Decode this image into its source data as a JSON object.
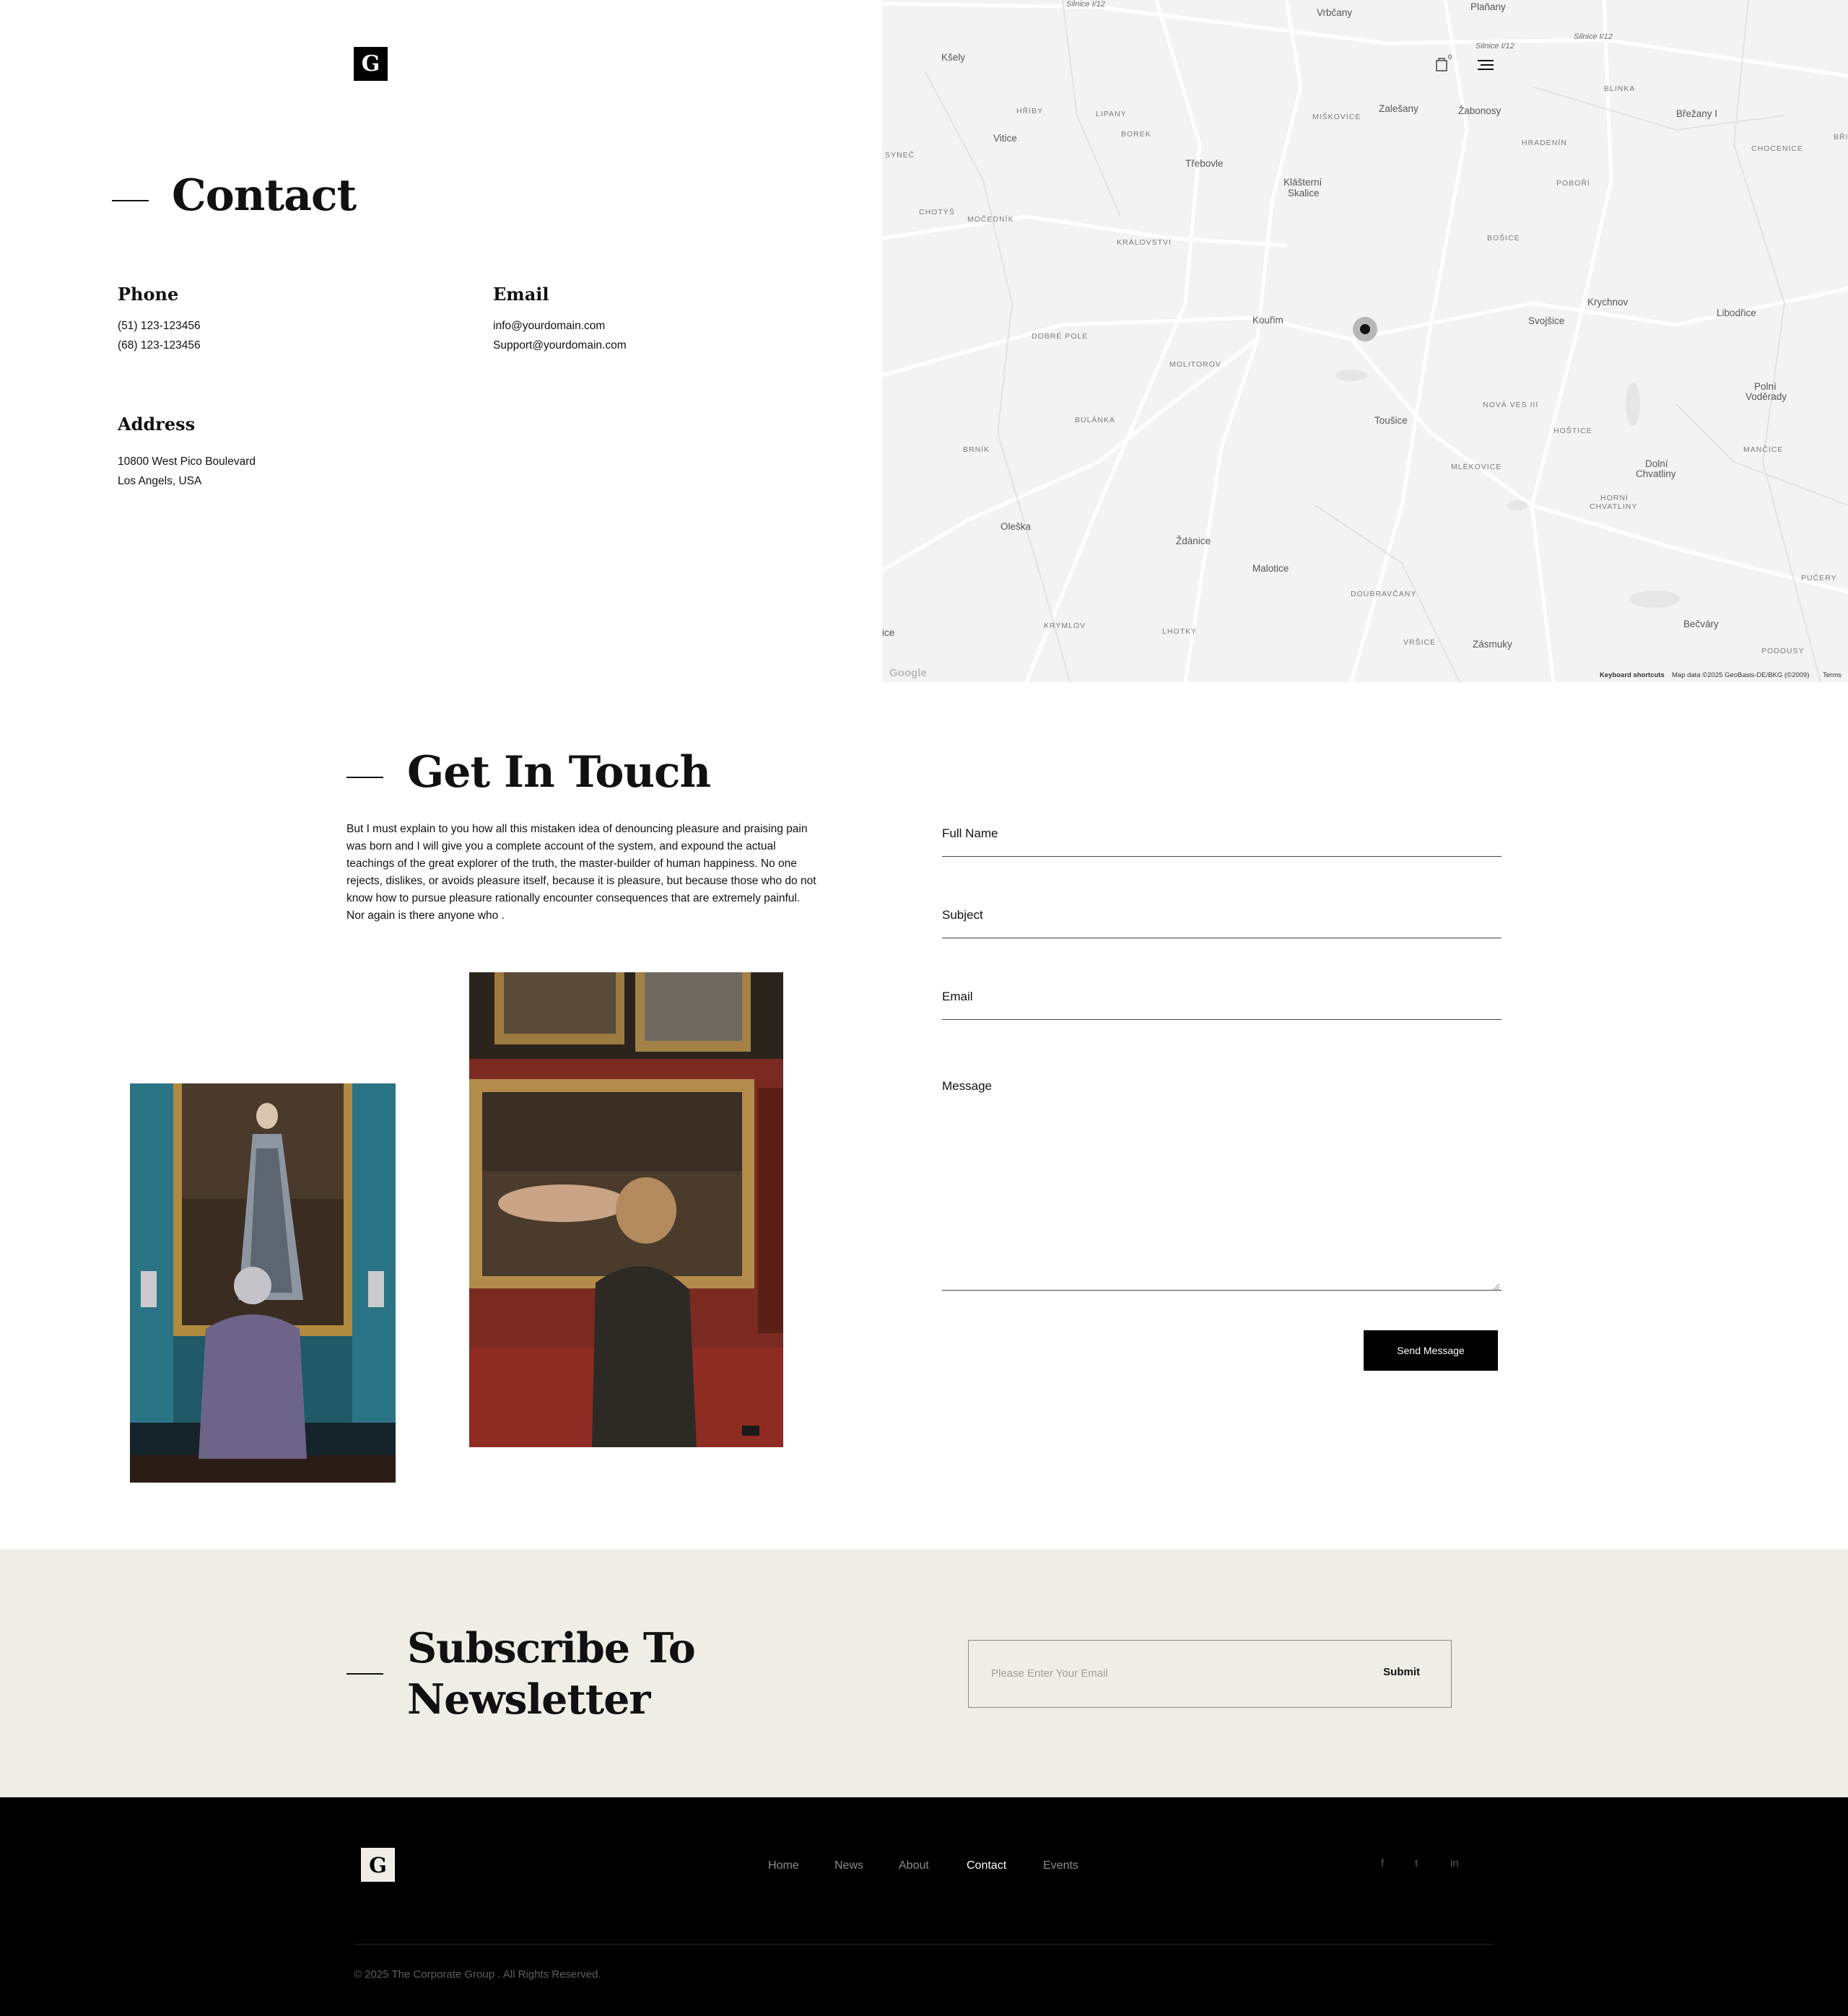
{
  "header": {
    "logo_letter": "G",
    "cart_count": "0"
  },
  "contact": {
    "title": "Contact",
    "phone_title": "Phone",
    "phones": [
      "(51) 123-123456",
      "(68) 123-123456"
    ],
    "email_title": "Email",
    "emails": [
      "info@yourdomain.com",
      "Support@yourdomain.com"
    ],
    "address_title": "Address",
    "address_lines": [
      "10800 West Pico Boulevard",
      "Los Angels, USA"
    ]
  },
  "map": {
    "labels": {
      "l1": "Silnice I/12",
      "l2": "Vrbčany",
      "l3": "Plaňany",
      "l4": "Silnice I/12",
      "l5": "Silnice I/12",
      "l6": "Kšely",
      "l7": "BLINKA",
      "l8": "HŘÍBY",
      "l9": "LIPANY",
      "l10": "Zalešany",
      "l11": "Žabonosy",
      "l12": "Břežany I",
      "l13": "MIŠKOVICE",
      "l14": "Vitice",
      "l15": "BOREK",
      "l16": "HRADENÍN",
      "l17": "CHOCENICE",
      "l18": "BŘI",
      "l19": "SYNEČ",
      "l20": "Třebovle",
      "l21": "POBOŘÍ",
      "l22": "Klášterní",
      "l23": "Skalice",
      "l24": "CHOTÝŠ",
      "l25": "MOČEDNÍK",
      "l26": "KRÁLOVSTVÍ",
      "l27": "BOŠICE",
      "l28": "Krychnov",
      "l29": "Libodřice",
      "l30": "Kouřim",
      "l31": "Svojšice",
      "l32": "DOBRÉ POLE",
      "l33": "MOLITOROV",
      "l34": "Polní",
      "l35": "Voděrady",
      "l36": "NOVÁ VES III",
      "l37": "Toušice",
      "l38": "BULÁNKA",
      "l39": "HOŠTICE",
      "l40": "BRNÍK",
      "l41": "MANČICE",
      "l42": "MLÉKOVICE",
      "l43": "Dolní",
      "l44": "Chvatliny",
      "l45": "HORNÍ",
      "l46": "CHVATLINY",
      "l47": "Oleška",
      "l48": "Ždánice",
      "l49": "PUČERY",
      "l50": "Malotice",
      "l51": "DOUBRAVČANY",
      "l52": "KRYMLOV",
      "l53": "LHOTKY",
      "l54": "Bečváry",
      "l55": "ice",
      "l56": "VRŠICE",
      "l57": "Zásmuky",
      "l58": "PODOUSY"
    },
    "google_logo": "Google",
    "shortcuts": "Keyboard shortcuts",
    "attribution": "Map data ©2025 GeoBasis-DE/BKG (©2009)",
    "terms": "Terms"
  },
  "touch": {
    "title": "Get In Touch",
    "paragraph_lines": [
      "But I must explain to you how all this mistaken idea of denouncing pleasure and praising pain",
      "was born and I will give you a complete account of the system, and expound the actual",
      "teachings of the great explorer of the truth, the master-builder of human happiness. No one",
      "rejects, dislikes, or avoids pleasure itself, because it is pleasure, but because those who do not",
      "know how to pursue pleasure rationally encounter consequences that are extremely painful.",
      "Nor again is there anyone who ."
    ],
    "form": {
      "full_name": "Full Name",
      "subject": "Subject",
      "email": "Email",
      "message": "Message",
      "send": "Send Message"
    }
  },
  "newsletter": {
    "title_line1": "Subscribe To",
    "title_line2": "Newsletter",
    "placeholder": "Please Enter Your Email",
    "submit": "Submit"
  },
  "footer": {
    "logo_letter": "G",
    "nav": [
      "Home",
      "News",
      "About",
      "Contact",
      "Events"
    ],
    "active_nav": "Contact",
    "social": [
      "f",
      "t",
      "in"
    ],
    "copyright": "© 2025 The Corporate Group . All Rights Reserved."
  },
  "colors": {
    "accent": "#000000",
    "newsletter_bg": "#f0ede6",
    "map_bg": "#f3f3f3"
  }
}
